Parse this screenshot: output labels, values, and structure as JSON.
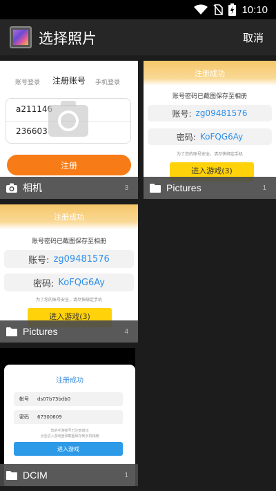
{
  "status_bar": {
    "time": "10:10"
  },
  "app_bar": {
    "title": "选择照片",
    "cancel_label": "取消"
  },
  "albums": [
    {
      "name": "相机",
      "count": "3",
      "icon": "camera-icon"
    },
    {
      "name": "Pictures",
      "count": "1",
      "icon": "folder-icon"
    },
    {
      "name": "Pictures",
      "count": "4",
      "icon": "folder-icon"
    },
    {
      "name": "DCIM",
      "count": "1",
      "icon": "folder-icon"
    }
  ],
  "thumb_register": {
    "tab_account": "账号登录",
    "tab_register": "注册账号",
    "tab_phone": "手机登录",
    "field_account": "a211146",
    "field_password": "236603",
    "submit": "注册"
  },
  "thumb_success_small": {
    "header": "注册成功",
    "notice": "账号密码已截图保存至相册",
    "account_key": "账号:",
    "account_value": "zg09481576",
    "password_key": "密码:",
    "password_value": "KoFQG6Ay",
    "tip": "为了您的账号安全，请尽快绑定手机",
    "button": "进入游戏(3)"
  },
  "thumb_success_large": {
    "header": "注册成功",
    "notice": "账号密码已截图保存至相册",
    "account_key": "账号:",
    "account_value": "zg09481576",
    "password_key": "密码:",
    "password_value": "KoFQG6Ay",
    "tip": "为了您的账号安全，请尽快绑定手机",
    "button": "进入游戏(3)"
  },
  "thumb_dcim": {
    "title": "注册成功",
    "account_key": "帐号",
    "account_value": "ds07b73bdb0",
    "password_key": "密码",
    "password_value": "67300609",
    "tip_line1": "您的手游帐号已注册成功",
    "tip_line2": "点击进入游戏登录截图保存到手机相册",
    "button": "进入游戏"
  },
  "colors": {
    "accent_orange": "#f77b16",
    "accent_blue": "#2f8fe8",
    "button_yellow": "#ffd20a"
  }
}
